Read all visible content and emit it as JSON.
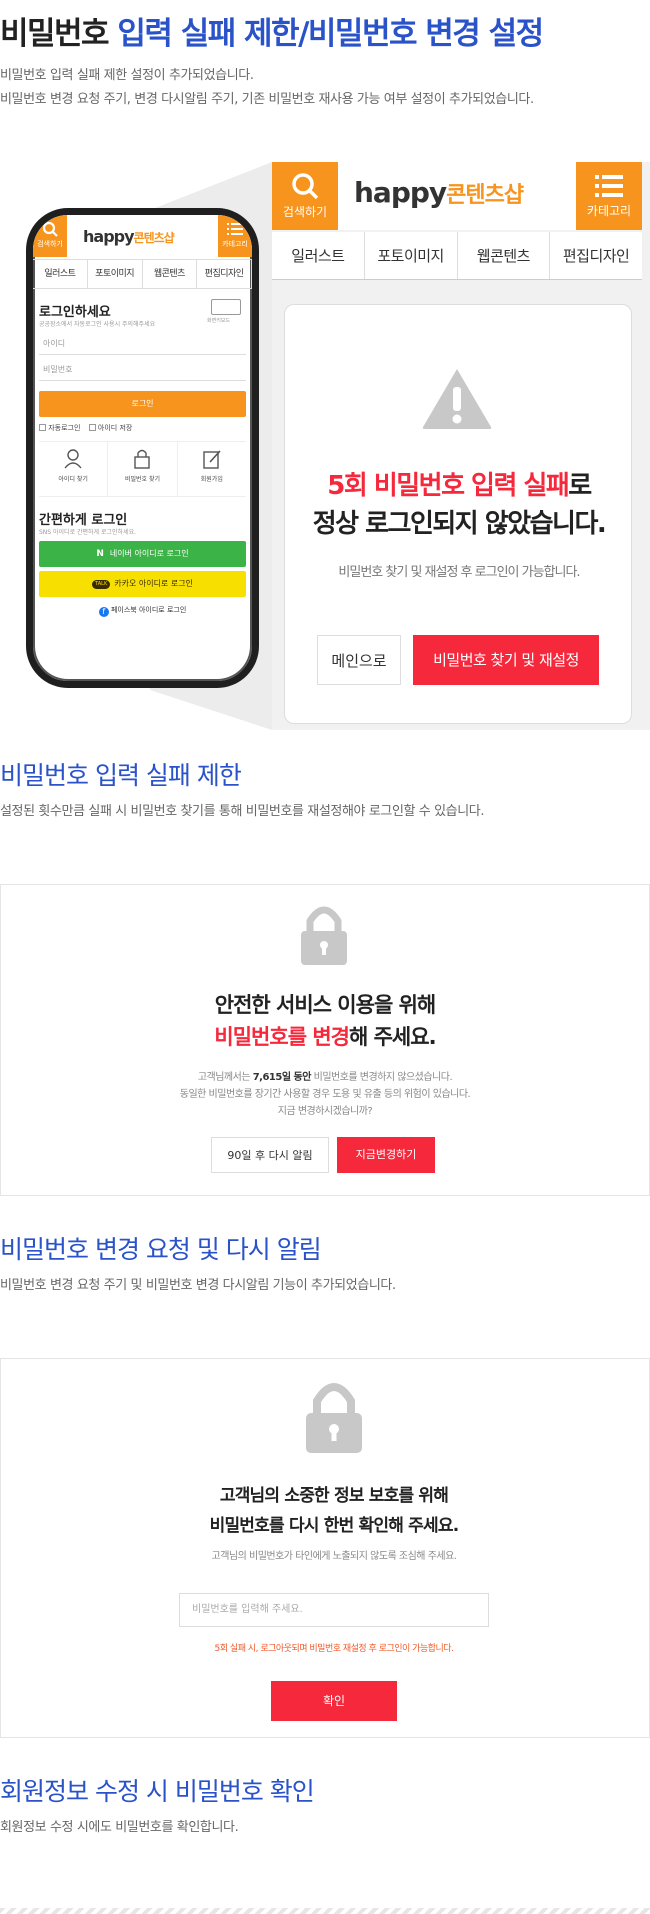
{
  "header": {
    "title_prefix": "비밀번호 ",
    "title_blue": "입력 실패 제한/비밀번호 변경 설정",
    "desc_1": "비밀번호 입력 실패 제한 설정이 추가되었습니다.",
    "desc_2": "비밀번호 변경 요청 주기, 변경 다시알림 주기, 기존 비밀번호 재사용 가능 여부 설정이 추가되었습니다."
  },
  "phone": {
    "search_label": "검색하기",
    "category_label": "카테고리",
    "logo_en": "happy",
    "logo_ko": "콘텐츠샵",
    "tabs": [
      "일러스트",
      "포토이미지",
      "웹콘텐츠",
      "편집디자인"
    ],
    "login_title": "로그인하세요",
    "login_sub": "공공장소에서 자동로그인 사용시 주의해주세요",
    "keyboard_label": "화면키보드",
    "id_placeholder": "아이디",
    "pw_placeholder": "비밀번호",
    "login_button": "로그인",
    "auto_login": "자동로그인",
    "save_id": "아이디 저장",
    "find_id": "아이디 찾기",
    "find_pw": "비밀번호 찾기",
    "join": "회원가입",
    "easy_login_title": "간편하게 로그인",
    "easy_login_sub": "SNS 아이디로 간편하게 로그인하세요.",
    "naver_login": "네이버 아이디로 로그인",
    "kakao_login": "카카오 아이디로 로그인",
    "kakao_badge": "TALK",
    "facebook_login": "페이스북 아이디로 로그인"
  },
  "zoom": {
    "search_label": "검색하기",
    "category_label": "카테고리",
    "tabs": [
      "일러스트",
      "포토이미지",
      "웹콘텐츠",
      "편집디자인"
    ],
    "msg_red": "5회 비밀번호 입력 실패",
    "msg_suffix": "로",
    "msg_line2": "정상 로그인되지 않았습니다.",
    "msg_sub": "비밀번호 찾기 및 재설정 후 로그인이 가능합니다.",
    "main_button": "메인으로",
    "reset_button": "비밀번호 찾기 및 재설정"
  },
  "section1": {
    "title": "비밀번호 입력 실패 제한",
    "desc": "설정된 횟수만큼 실패 시 비밀번호 찾기를 통해 비밀번호를 재설정해야 로그인할 수 있습니다."
  },
  "box1": {
    "line1": "안전한 서비스 이용을 위해",
    "line2_red": "비밀번호를 변경",
    "line2_suffix": "해 주세요.",
    "info1_prefix": "고객님께서는 ",
    "info1_bold": "7,615일 동안",
    "info1_suffix": " 비밀번호를 변경하지 않으셨습니다.",
    "info2": "동일한 비밀번호를 장기간 사용할 경우 도용 및 유출 등의 위험이 있습니다.",
    "info3": "지금 변경하시겠습니까?",
    "later_button": "90일 후 다시 알림",
    "change_button": "지금변경하기"
  },
  "section2": {
    "title": "비밀번호 변경 요청 및 다시 알림",
    "desc": "비밀번호 변경 요청 주기 및 비밀번호 변경 다시알림 기능이 추가되었습니다."
  },
  "box2": {
    "line1": "고객님의 소중한 정보 보호를 위해",
    "line2": "비밀번호를 다시 한번 확인해 주세요.",
    "sub": "고객님의 비밀번호가 타인에게 노출되지 않도록 조심해 주세요.",
    "pw_placeholder": "비밀번호를 입력해 주세요.",
    "warning": "5회 실패 시, 로그아웃되며 비밀번호 재설정 후 로그인이 가능합니다.",
    "confirm_button": "확인"
  },
  "section3": {
    "title": "회원정보 수정 시 비밀번호 확인",
    "desc": "회원정보 수정 시에도 비밀번호를 확인합니다."
  },
  "colors": {
    "blue": "#2a52c9",
    "orange": "#f7941d",
    "red": "#f5283c",
    "naver": "#3cb347",
    "kakao": "#f7e000"
  }
}
